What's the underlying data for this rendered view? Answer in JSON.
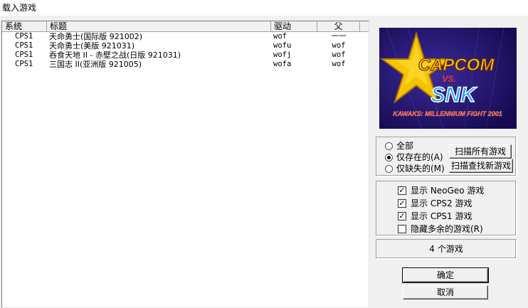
{
  "window": {
    "title": "载入游戏"
  },
  "list": {
    "headers": {
      "system": "系统",
      "title": "标题",
      "driver": "驱动",
      "parent": "父"
    },
    "rows": [
      {
        "system": "CPS1",
        "title": "天命勇士(国际版 921002)",
        "driver": "wof",
        "parent": "一一"
      },
      {
        "system": "CPS1",
        "title": "天命勇士(美版 921031)",
        "driver": "wofu",
        "parent": "wof"
      },
      {
        "system": "CPS1",
        "title": "吞食天地 II - 赤壁之战(日版 921031)",
        "driver": "wofj",
        "parent": "wof"
      },
      {
        "system": "CPS1",
        "title": "三国志 II(亚洲版 921005)",
        "driver": "wofa",
        "parent": "wof"
      }
    ]
  },
  "preview": {
    "logo_top": "CAPCOM",
    "logo_vs": "VS.",
    "logo_bottom": "SNK",
    "subtitle": "KAWAKS: MILLENNIUM FIGHT 2001",
    "colors": {
      "background": "#2a1a70",
      "star": "#f5c400",
      "capcom": "#f4d000",
      "snk": "#2aa0ff",
      "subtitle": "#ff3020"
    }
  },
  "filter": {
    "options": [
      {
        "label": "全部",
        "checked": false
      },
      {
        "label": "仅存在的(A)",
        "checked": true
      },
      {
        "label": "仅缺失的(M)",
        "checked": false
      }
    ],
    "scan_all_button": "扫描所有游戏",
    "scan_new_button": "扫描查找新游戏"
  },
  "display": {
    "options": [
      {
        "label": "显示 NeoGeo 游戏",
        "checked": true
      },
      {
        "label": "显示 CPS2 游戏",
        "checked": true
      },
      {
        "label": "显示 CPS1 游戏",
        "checked": true
      },
      {
        "label": "隐藏多余的游戏(R)",
        "checked": false
      }
    ]
  },
  "status": {
    "count_text": "4 个游戏"
  },
  "buttons": {
    "ok": "确定",
    "cancel": "取消"
  }
}
